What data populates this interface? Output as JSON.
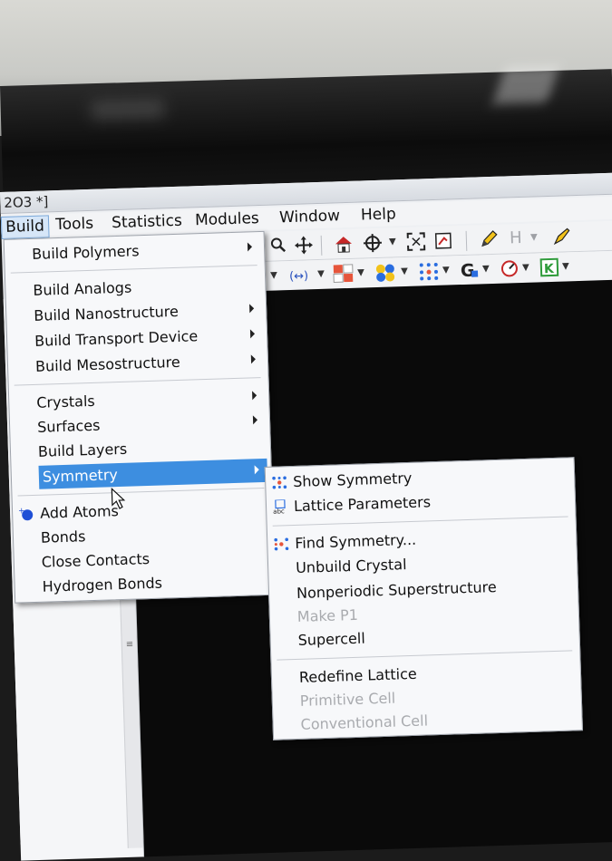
{
  "window": {
    "title": "2O3 *]"
  },
  "menubar": [
    {
      "label": "Build",
      "active": true
    },
    {
      "label": "Tools"
    },
    {
      "label": "Statistics"
    },
    {
      "label": "Modules"
    },
    {
      "label": "Window"
    },
    {
      "label": "Help"
    }
  ],
  "toolbar": {
    "row1": [
      "search-icon",
      "move-icon",
      "home-icon",
      "crosshair-icon",
      "fit-icon",
      "viewer-icon",
      "pencil-icon",
      "hydrogen-label",
      "brush-icon"
    ],
    "hydrogen_label": "H",
    "row2": [
      "measure-icon",
      "atoms-table-icon",
      "balls-icon",
      "lattice-icon",
      "g-icon",
      "compass-icon",
      "k-icon"
    ]
  },
  "build_menu": {
    "items": [
      {
        "label": "Build Polymers",
        "submenu": true
      },
      {
        "label": "Build Analogs",
        "submenu": false
      },
      {
        "label": "Build Nanostructure",
        "submenu": true
      },
      {
        "label": "Build Transport Device",
        "submenu": true
      },
      {
        "label": "Build Mesostructure",
        "submenu": true
      },
      {
        "label": "Crystals",
        "submenu": true
      },
      {
        "label": "Surfaces",
        "submenu": true
      },
      {
        "label": "Build Layers",
        "submenu": false
      },
      {
        "label": "Symmetry",
        "submenu": true,
        "selected": true
      },
      {
        "label": "Add Atoms",
        "submenu": false,
        "icon": "add-atoms-icon"
      },
      {
        "label": "Bonds",
        "submenu": false
      },
      {
        "label": "Close Contacts",
        "submenu": false
      },
      {
        "label": "Hydrogen Bonds",
        "submenu": false
      }
    ]
  },
  "symmetry_menu": {
    "items": [
      {
        "label": "Show Symmetry",
        "icon": "symmetry-dots-icon",
        "enabled": true
      },
      {
        "label": "Lattice Parameters",
        "icon": "lattice-abc-icon",
        "enabled": true
      },
      {
        "label": "Find Symmetry...",
        "icon": "find-symmetry-icon",
        "enabled": true
      },
      {
        "label": "Unbuild Crystal",
        "enabled": true
      },
      {
        "label": "Nonperiodic Superstructure",
        "enabled": true
      },
      {
        "label": "Make P1",
        "enabled": false
      },
      {
        "label": "Supercell",
        "enabled": true
      },
      {
        "label": "Redefine Lattice",
        "enabled": true
      },
      {
        "label": "Primitive Cell",
        "enabled": false
      },
      {
        "label": "Conventional Cell",
        "enabled": false
      }
    ],
    "lattice_icon_text": "abc"
  },
  "colors": {
    "selection": "#3d8ee0",
    "menu_bg": "#f7f8fa",
    "disabled": "#a9abaf",
    "viewport": "#0a0a0a"
  }
}
